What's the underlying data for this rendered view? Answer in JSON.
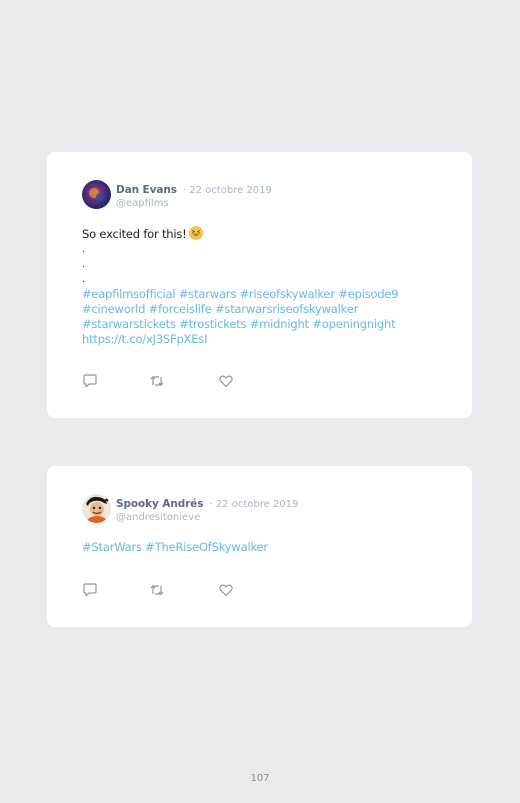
{
  "tweets": [
    {
      "author_name": "Dan Evans",
      "date": "· 22 octobre 2019",
      "handle": "@eapfilms",
      "text": "So excited for this!",
      "emoji": "grinning-squinting-face-icon",
      "dots": [
        ".",
        ".",
        "."
      ],
      "hashtag_lines": [
        "#eapfilmsofficial #starwars #riseofskywalker #episode9",
        "#cineworld #forceislife #starwarsriseofskywalker",
        "#starwarstickets #trostickets #midnight #openingnight",
        "https://t.co/xJ3SFpXEsI"
      ]
    },
    {
      "author_name": "Spooky Andrés",
      "date": "· 22 octobre 2019",
      "handle": "@andresitonieve",
      "hashtag_line": "#StarWars #TheRiseOfSkywalker"
    }
  ],
  "colors": {
    "background": "#ebebef",
    "card": "#ffffff",
    "link": "#6ab7e5",
    "name": "#5b6e7f",
    "meta": "#a9b6c2",
    "icon": "#8a9aa8"
  },
  "icons": {
    "reply": "reply-icon",
    "retweet": "retweet-icon",
    "like": "like-icon"
  },
  "page_number": "107"
}
